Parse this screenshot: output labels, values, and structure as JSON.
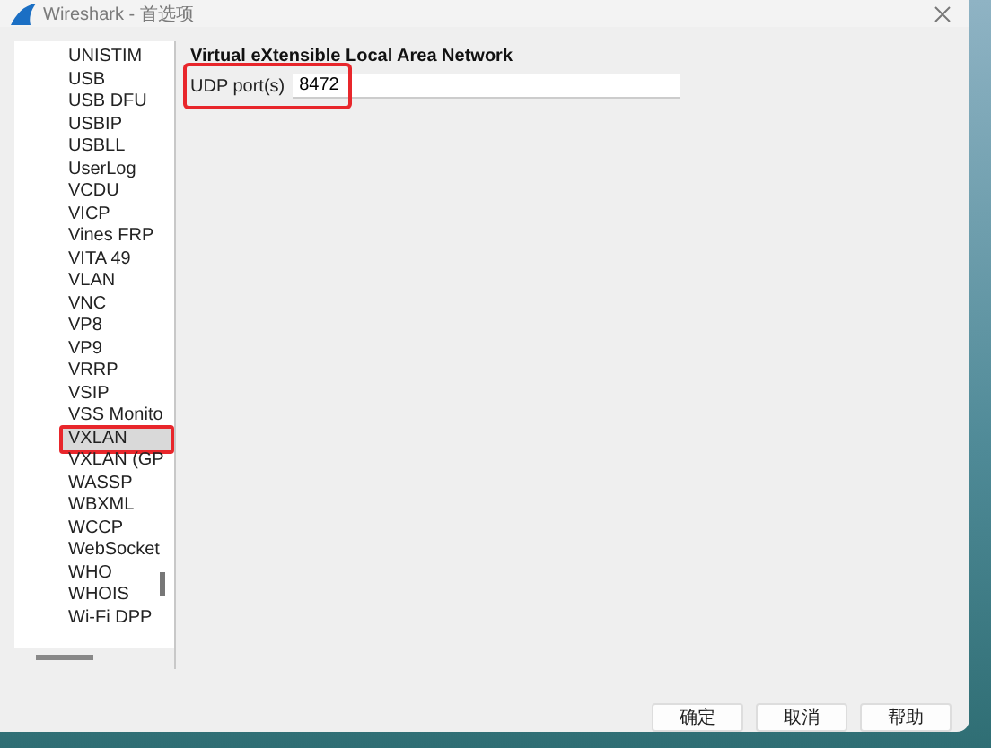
{
  "window": {
    "title": "Wireshark - 首选项"
  },
  "sidebar": {
    "items": [
      {
        "label": "UNISTIM",
        "selected": false
      },
      {
        "label": "USB",
        "selected": false
      },
      {
        "label": "USB DFU",
        "selected": false
      },
      {
        "label": "USBIP",
        "selected": false
      },
      {
        "label": "USBLL",
        "selected": false
      },
      {
        "label": "UserLog",
        "selected": false
      },
      {
        "label": "VCDU",
        "selected": false
      },
      {
        "label": "VICP",
        "selected": false
      },
      {
        "label": "Vines FRP",
        "selected": false
      },
      {
        "label": "VITA 49",
        "selected": false
      },
      {
        "label": "VLAN",
        "selected": false
      },
      {
        "label": "VNC",
        "selected": false
      },
      {
        "label": "VP8",
        "selected": false
      },
      {
        "label": "VP9",
        "selected": false
      },
      {
        "label": "VRRP",
        "selected": false
      },
      {
        "label": "VSIP",
        "selected": false
      },
      {
        "label": "VSS Monito",
        "selected": false
      },
      {
        "label": "VXLAN",
        "selected": true
      },
      {
        "label": "VXLAN (GP",
        "selected": false
      },
      {
        "label": "WASSP",
        "selected": false
      },
      {
        "label": "WBXML",
        "selected": false
      },
      {
        "label": "WCCP",
        "selected": false
      },
      {
        "label": "WebSocket",
        "selected": false
      },
      {
        "label": "WHO",
        "selected": false
      },
      {
        "label": "WHOIS",
        "selected": false
      },
      {
        "label": "Wi-Fi DPP",
        "selected": false
      }
    ]
  },
  "panel": {
    "heading": "Virtual eXtensible Local Area Network",
    "fields": [
      {
        "label": "UDP port(s)",
        "value": "8472"
      }
    ]
  },
  "buttons": [
    "确定",
    "取消",
    "帮助"
  ]
}
